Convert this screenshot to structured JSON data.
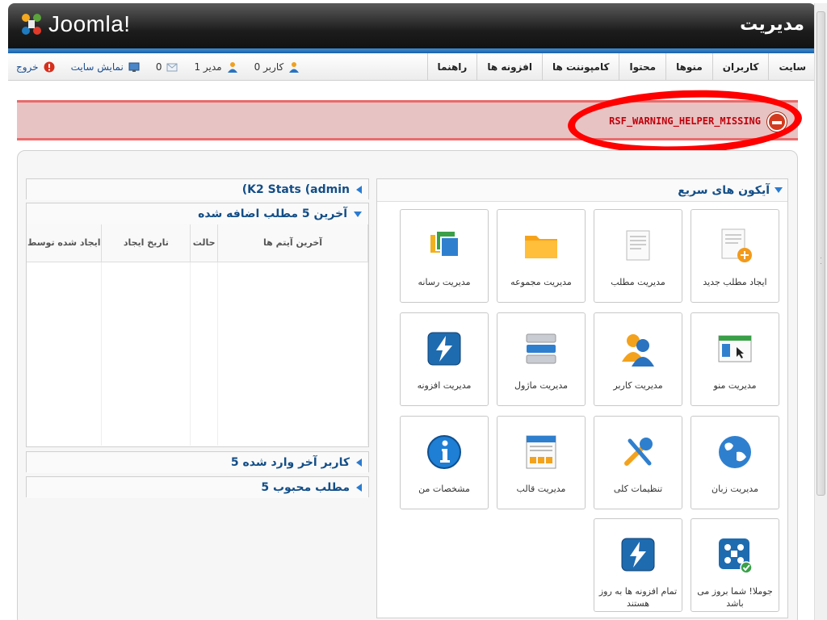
{
  "header": {
    "logo_text": "Joomla!",
    "title": "مدیریت"
  },
  "menu": [
    {
      "label": "سایت"
    },
    {
      "label": "کاربران"
    },
    {
      "label": "منوها"
    },
    {
      "label": "محتوا"
    },
    {
      "label": "کامپوننت ها"
    },
    {
      "label": "افزونه ها"
    },
    {
      "label": "راهنما"
    }
  ],
  "status": {
    "users": "0 کاربر",
    "admins": "1 مدیر",
    "messages": "0",
    "view_site": "نمایش سایت",
    "logout": "خروج"
  },
  "warning": {
    "text": "RSF_WARNING_HELPER_MISSING"
  },
  "quick_icons": {
    "title": "آیکون های سریع",
    "items": [
      {
        "label": "ایجاد مطلب جدید",
        "icon": "new-article-icon"
      },
      {
        "label": "مدیریت مطلب",
        "icon": "article-icon"
      },
      {
        "label": "مدیریت مجموعه",
        "icon": "folder-icon"
      },
      {
        "label": "مدیریت رسانه",
        "icon": "media-icon"
      },
      {
        "label": "مدیریت منو",
        "icon": "menu-icon"
      },
      {
        "label": "مدیریت کاربر",
        "icon": "user-icon"
      },
      {
        "label": "مدیریت ماژول",
        "icon": "module-icon"
      },
      {
        "label": "مدیریت افزونه",
        "icon": "plugin-icon"
      },
      {
        "label": "مدیریت زبان",
        "icon": "globe-icon"
      },
      {
        "label": "تنظیمات کلی",
        "icon": "tools-icon"
      },
      {
        "label": "مدیریت قالب",
        "icon": "template-icon"
      },
      {
        "label": "مشخصات من",
        "icon": "info-icon"
      },
      {
        "label": "جوملا! شما بروز می باشد",
        "icon": "joomla-update-icon"
      },
      {
        "label": "تمام افزونه ها به روز هستند",
        "icon": "plugin-update-icon"
      }
    ]
  },
  "left_panels": {
    "k2_stats": "(K2 Stats (admin",
    "latest_added": {
      "title": "آخرین 5 مطلب اضافه شده",
      "columns": [
        "آخرین آیتم ها",
        "حالت",
        "تاریخ ایجاد",
        "ایجاد شده توسط"
      ]
    },
    "latest_users": "5 کاربر آخر وارد شده",
    "popular": "5 مطلب محبوب"
  }
}
